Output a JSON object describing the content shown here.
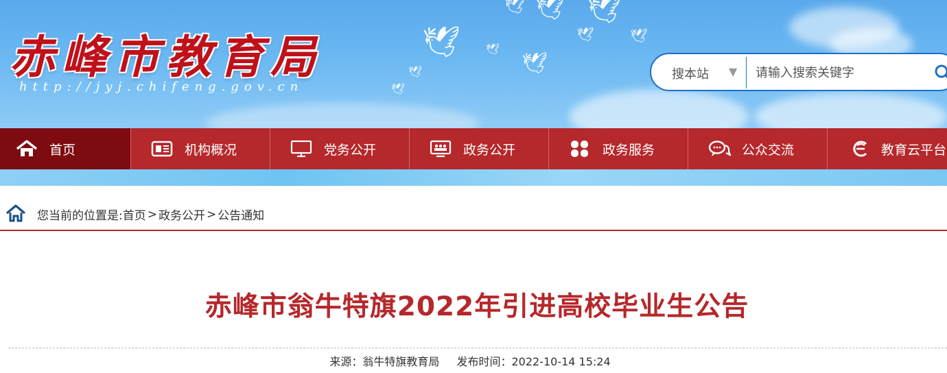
{
  "header": {
    "title": "赤峰市教育局",
    "url": "http://jyj.chifeng.gov.cn"
  },
  "search": {
    "scope_label": "搜本站",
    "placeholder": "请输入搜索关键字",
    "value": ""
  },
  "nav": {
    "items": [
      {
        "label": "首页",
        "icon": "home-icon"
      },
      {
        "label": "机构概况",
        "icon": "newspaper-icon"
      },
      {
        "label": "党务公开",
        "icon": "monitor-icon"
      },
      {
        "label": "政务公开",
        "icon": "meeting-screen-icon"
      },
      {
        "label": "政务服务",
        "icon": "grid-icon"
      },
      {
        "label": "公众交流",
        "icon": "chat-icon"
      },
      {
        "label": "教育云平台",
        "icon": "cloud-e-icon"
      }
    ]
  },
  "breadcrumb": {
    "prefix": "您当前的位置是:",
    "items": [
      "首页",
      "政务公开",
      "公告通知"
    ],
    "separator": ">"
  },
  "article": {
    "title": "赤峰市翁牛特旗2022年引进高校毕业生公告",
    "source_label": "来源：",
    "source": "翁牛特旗教育局",
    "time_label": "发布时间：",
    "time": "2022-10-14 15:24"
  },
  "colors": {
    "brand_red": "#b5282b",
    "nav_active": "#7d0b10",
    "title_red": "#c0111b",
    "search_border": "#1f6fc0"
  }
}
